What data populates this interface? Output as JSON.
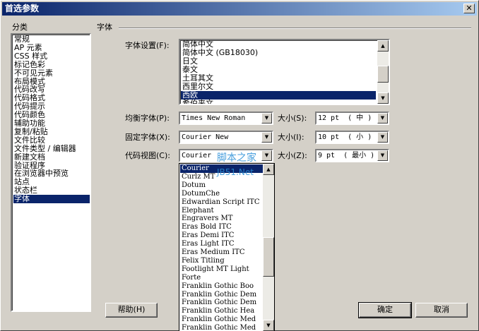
{
  "window": {
    "title": "首选参数",
    "close_glyph": "✕"
  },
  "sidebar": {
    "heading": "分类",
    "items": [
      {
        "label": "常规"
      },
      {
        "label": "AP 元素"
      },
      {
        "label": "CSS 样式"
      },
      {
        "label": "标记色彩"
      },
      {
        "label": "不可见元素"
      },
      {
        "label": "布局模式"
      },
      {
        "label": "代码改写"
      },
      {
        "label": "代码格式"
      },
      {
        "label": "代码提示"
      },
      {
        "label": "代码颜色"
      },
      {
        "label": "辅助功能"
      },
      {
        "label": "复制/粘贴"
      },
      {
        "label": "文件比较"
      },
      {
        "label": "文件类型 / 编辑器"
      },
      {
        "label": "新建文档"
      },
      {
        "label": "验证程序"
      },
      {
        "label": "在浏览器中预览"
      },
      {
        "label": "站点"
      },
      {
        "label": "状态栏"
      },
      {
        "label": "字体",
        "selected": true
      }
    ]
  },
  "panel": {
    "heading": "字体"
  },
  "font_settings": {
    "label": "字体设置(F):",
    "items": [
      {
        "label": "简体中文"
      },
      {
        "label": "简体中文 (GB18030)"
      },
      {
        "label": "日文"
      },
      {
        "label": "泰文"
      },
      {
        "label": "土耳其文"
      },
      {
        "label": "西里尔文"
      },
      {
        "label": "西欧",
        "selected": true
      },
      {
        "label": "希伯来文"
      }
    ]
  },
  "proportional": {
    "label": "均衡字体(P):",
    "value": "Times New Roman",
    "size_label": "大小(S):",
    "size_value": "12 pt  ( 中 )"
  },
  "fixed": {
    "label": "固定字体(X):",
    "value": "Courier New",
    "size_label": "大小(I):",
    "size_value": "10 pt  ( 小 )"
  },
  "code_view": {
    "label": "代码视图(C):",
    "value": "Courier",
    "size_label": "大小(Z):",
    "size_value": "9 pt  ( 最小 )"
  },
  "dropdown": {
    "items": [
      {
        "label": "Courier",
        "selected": true
      },
      {
        "label": "Curlz MT"
      },
      {
        "label": "Dotum"
      },
      {
        "label": "DotumChe"
      },
      {
        "label": "Edwardian Script ITC"
      },
      {
        "label": "Elephant"
      },
      {
        "label": "Engravers MT"
      },
      {
        "label": "Eras Bold ITC"
      },
      {
        "label": "Eras Demi ITC"
      },
      {
        "label": "Eras Light ITC"
      },
      {
        "label": "Eras Medium ITC"
      },
      {
        "label": "Felix Titling"
      },
      {
        "label": "Footlight MT Light"
      },
      {
        "label": "Forte"
      },
      {
        "label": "Franklin Gothic Boo"
      },
      {
        "label": "Franklin Gothic Dem"
      },
      {
        "label": "Franklin Gothic Dem"
      },
      {
        "label": "Franklin Gothic Hea"
      },
      {
        "label": "Franklin Gothic Med"
      },
      {
        "label": "Franklin Gothic Med"
      }
    ]
  },
  "watermark": {
    "text": "脚本之家",
    "sub": "JB51.Net"
  },
  "buttons": {
    "help": "帮助(H)",
    "ok": "确定",
    "cancel": "取消"
  },
  "colors": {
    "selection": "#0a246a",
    "face": "#d4d0c8",
    "title_start": "#0a246a",
    "title_end": "#a6caf0"
  },
  "icons": {
    "scroll_up": "▲",
    "scroll_down": "▼",
    "combo_arrow": "▼"
  }
}
